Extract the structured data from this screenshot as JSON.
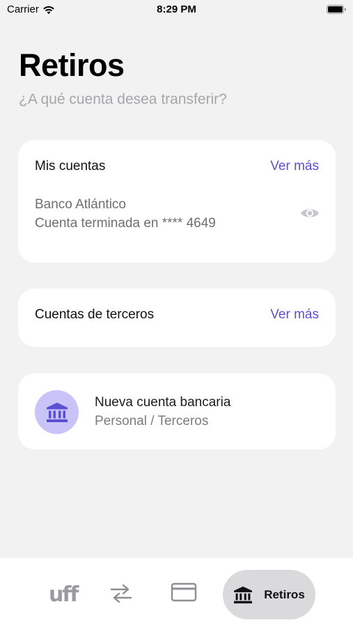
{
  "status_bar": {
    "carrier": "Carrier",
    "time": "8:29 PM",
    "icons": [
      "wifi-icon",
      "battery-icon"
    ]
  },
  "header": {
    "title": "Retiros",
    "subtitle": "¿A qué cuenta desea transferir?"
  },
  "mis_cuentas": {
    "title": "Mis cuentas",
    "link": "Ver más",
    "account": {
      "bank": "Banco Atlántico",
      "number_text": "Cuenta terminada en **** 4649",
      "icon": "eye-icon"
    }
  },
  "cuentas_terceros": {
    "title": "Cuentas de terceros",
    "link": "Ver más"
  },
  "nueva_cuenta": {
    "title": "Nueva cuenta bancaria",
    "subtitle": "Personal / Terceros",
    "icon": "bank-icon"
  },
  "tab_bar": {
    "items": [
      {
        "label": "uff",
        "icon": "uff-logo"
      },
      {
        "label": "",
        "icon": "transfer-arrows-icon"
      },
      {
        "label": "",
        "icon": "card-icon"
      },
      {
        "label": "Retiros",
        "icon": "bank-icon",
        "active": true
      }
    ]
  },
  "colors": {
    "accent": "#5d4fd4",
    "bank_circle": "#c9c4f7",
    "background": "#f2f2f2",
    "active_tab": "#dadadc"
  }
}
